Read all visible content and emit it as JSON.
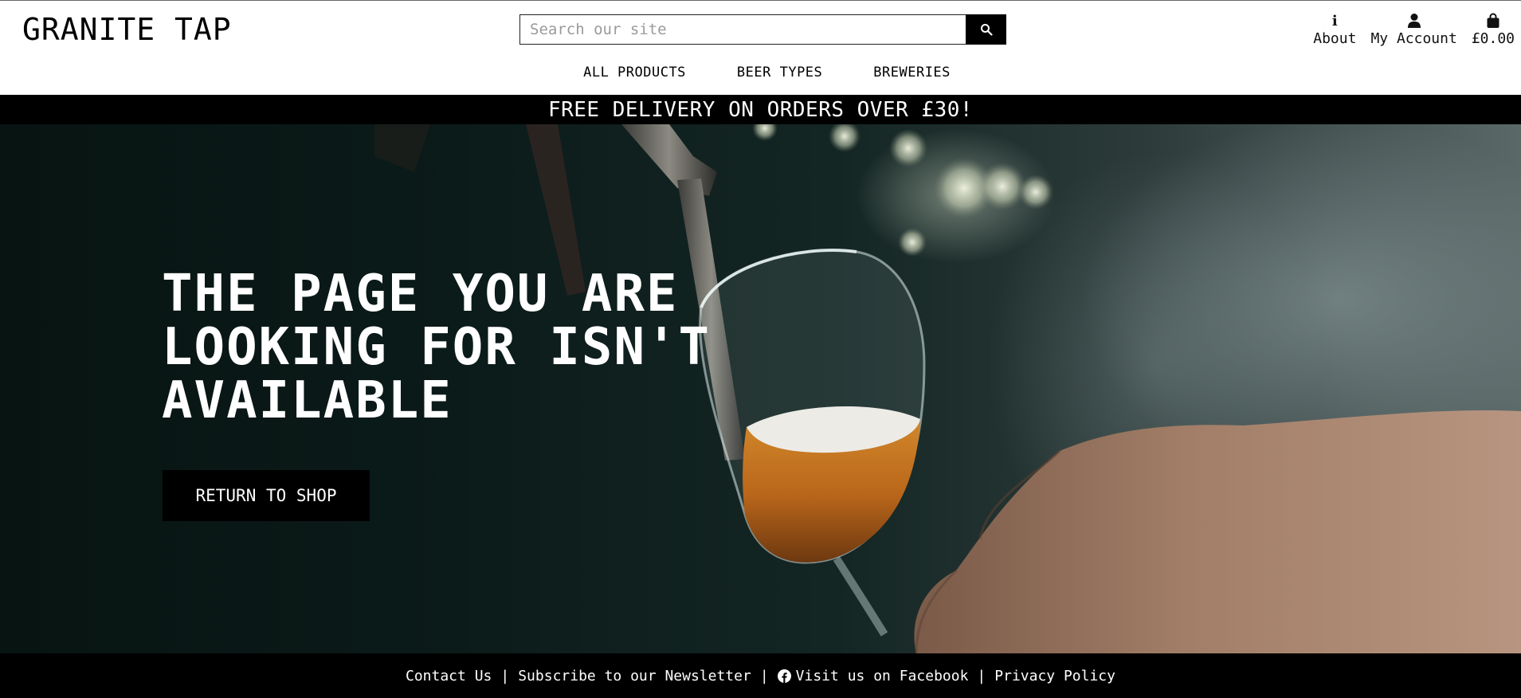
{
  "brand": {
    "name": "GRANITE TAP"
  },
  "search": {
    "placeholder": "Search our site",
    "button_icon": "search-icon"
  },
  "top_links": {
    "about": {
      "label": "About",
      "icon": "info-icon"
    },
    "account": {
      "label": "My Account",
      "icon": "user-icon"
    },
    "basket": {
      "label": "£0.00",
      "icon": "shopping-bag-icon"
    }
  },
  "nav": {
    "items": [
      {
        "label": "ALL PRODUCTS"
      },
      {
        "label": "BEER TYPES"
      },
      {
        "label": "BREWERIES"
      }
    ]
  },
  "banner": {
    "text": "FREE DELIVERY ON ORDERS OVER £30!"
  },
  "hero": {
    "title": "THE PAGE YOU ARE LOOKING FOR ISN'T AVAILABLE",
    "button_label": "RETURN TO SHOP"
  },
  "footer": {
    "contact": "Contact Us",
    "newsletter": "Subscribe to our Newsletter",
    "facebook": "Visit us on Facebook",
    "privacy": "Privacy Policy",
    "separator": "|"
  },
  "colors": {
    "header_bg": "#ffffff",
    "bar_bg": "#000000",
    "text_light": "#ffffff",
    "text_dark": "#000000"
  }
}
